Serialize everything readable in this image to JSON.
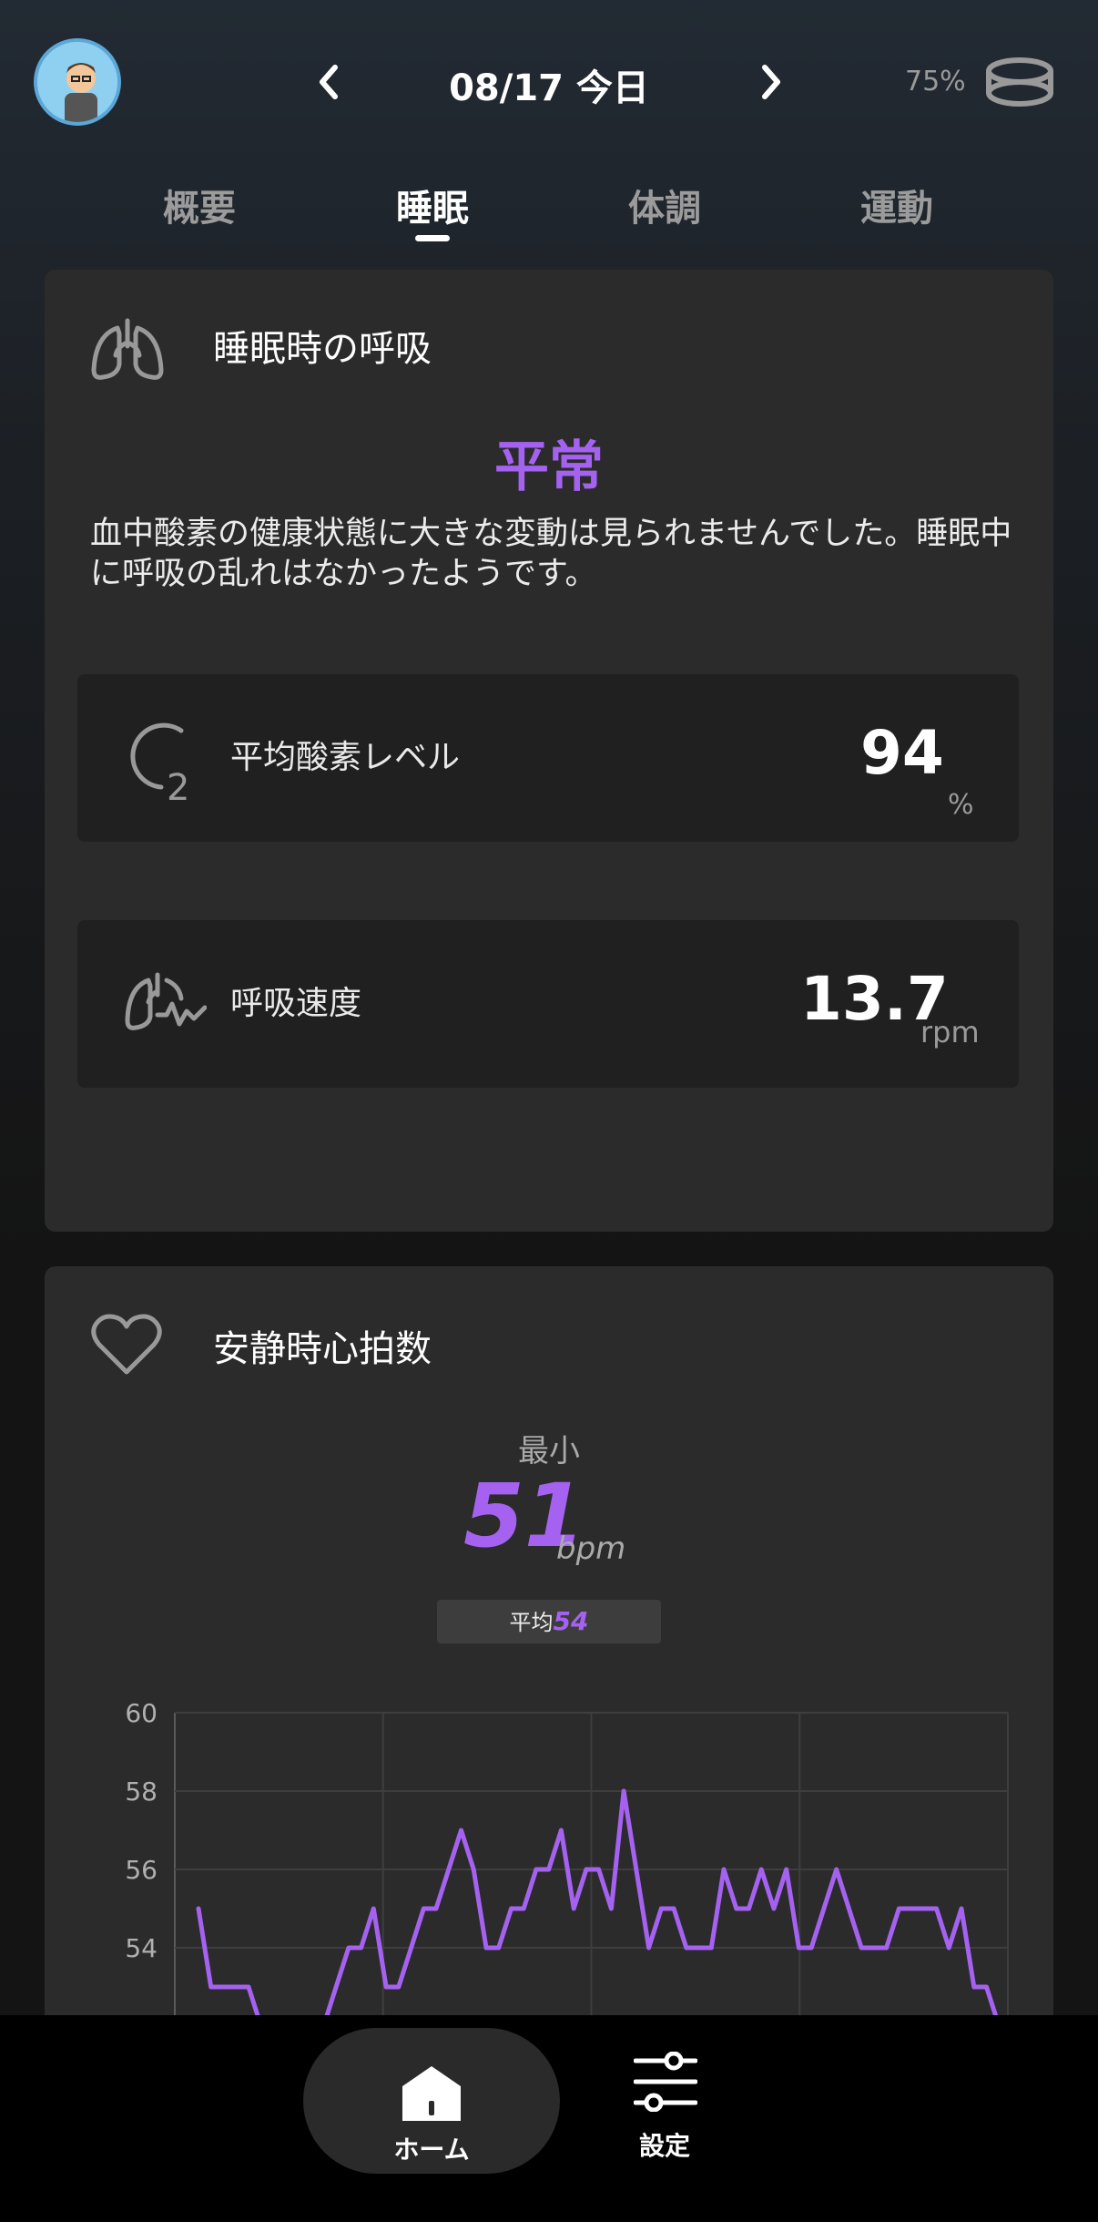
{
  "header": {
    "date": "08/17 今日",
    "battery": "75%",
    "icons": {
      "avatar": "avatar",
      "prev": "chevron-left-icon",
      "next": "chevron-right-icon",
      "ring": "ring-icon"
    }
  },
  "tabs": [
    {
      "label": "概要",
      "active": false
    },
    {
      "label": "睡眠",
      "active": true
    },
    {
      "label": "体調",
      "active": false
    },
    {
      "label": "運動",
      "active": false
    }
  ],
  "breathing_card": {
    "title": "睡眠時の呼吸",
    "status": "平常",
    "description": "血中酸素の健康状態に大きな変動は見られませんでした。睡眠中に呼吸の乱れはなかったようです。",
    "metrics": [
      {
        "label": "平均酸素レベル",
        "value": "94",
        "unit": "%",
        "icon": "o2-icon"
      },
      {
        "label": "呼吸速度",
        "value": "13.7",
        "unit": "rpm",
        "icon": "lungs-wave-icon"
      }
    ]
  },
  "heart_card": {
    "title": "安静時心拍数",
    "min_label": "最小",
    "min_value": "51",
    "min_unit": "bpm",
    "avg_label": "平均",
    "avg_value": "54"
  },
  "chart_data": {
    "type": "line",
    "ylim": [
      52,
      60
    ],
    "y_ticks": [
      60,
      58,
      56,
      54
    ],
    "tick_labels": [
      "60",
      "58",
      "56",
      "54"
    ],
    "grid": true,
    "color": "#a562f0",
    "series": [
      {
        "values": [
          55,
          53,
          53,
          53,
          53,
          52,
          52,
          51,
          51,
          51,
          52,
          53,
          54,
          54,
          55,
          53,
          53,
          54,
          55,
          55,
          56,
          57,
          56,
          54,
          54,
          55,
          55,
          56,
          56,
          57,
          55,
          56,
          56,
          55,
          58,
          56,
          54,
          55,
          55,
          54,
          54,
          54,
          56,
          55,
          55,
          56,
          55,
          56,
          54,
          54,
          55,
          56,
          55,
          54,
          54,
          54,
          55,
          55,
          55,
          55,
          54,
          55,
          53,
          53,
          52,
          51
        ]
      }
    ]
  },
  "bottom_nav": [
    {
      "label": "ホーム",
      "icon": "home-icon",
      "active": true
    },
    {
      "label": "設定",
      "icon": "sliders-icon",
      "active": false
    }
  ]
}
